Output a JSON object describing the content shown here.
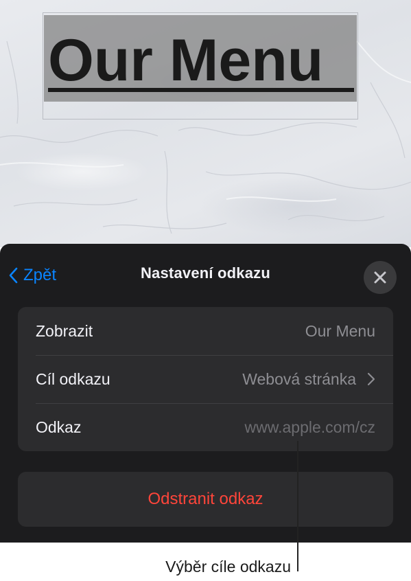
{
  "document": {
    "title_text": "Our Menu"
  },
  "sheet": {
    "back_label": "Zpět",
    "title": "Nastavení odkazu",
    "rows": [
      {
        "label": "Zobrazit",
        "value": "Our Menu"
      },
      {
        "label": "Cíl odkazu",
        "value": "Webová stránka"
      },
      {
        "label": "Odkaz",
        "placeholder": "www.apple.com/cz"
      }
    ],
    "remove_label": "Odstranit odkaz"
  },
  "callout": {
    "text": "Výběr cíle odkazu"
  },
  "colors": {
    "accent": "#0a84ff",
    "destructive": "#ff453a",
    "sheet_background": "#1c1c1e",
    "group_background": "#2c2c2e"
  },
  "icons": {
    "back": "chevron-left-icon",
    "close": "close-icon",
    "disclosure": "chevron-right-icon"
  }
}
